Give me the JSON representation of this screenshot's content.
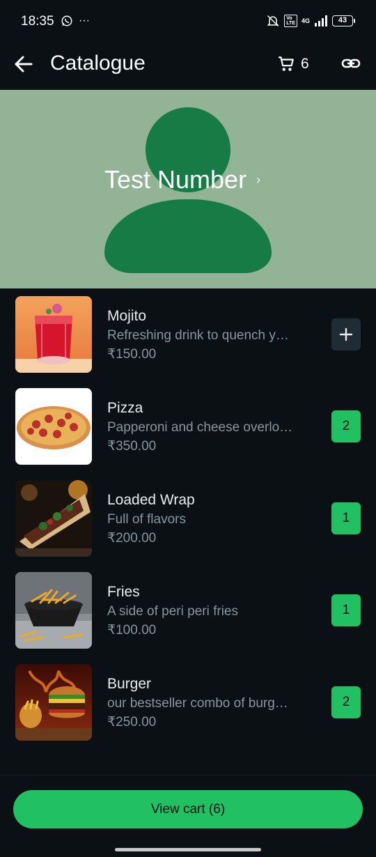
{
  "status_bar": {
    "time": "18:35",
    "more": "···",
    "network_label": "4G",
    "lte_label": "Vo\nLTE",
    "battery": "43"
  },
  "app_bar": {
    "title": "Catalogue",
    "cart_count": "6"
  },
  "banner": {
    "title": "Test Number",
    "chevron": "›",
    "background_color": "#93b397",
    "avatar_color": "#167b45"
  },
  "products": [
    {
      "name": "Mojito",
      "description": "Refreshing drink to quench y…",
      "price": "₹150.00",
      "quantity": null,
      "thumb": "mojito"
    },
    {
      "name": "Pizza",
      "description": "Papperoni and cheese overlo…",
      "price": "₹350.00",
      "quantity": "2",
      "thumb": "pizza"
    },
    {
      "name": "Loaded Wrap",
      "description": "Full of flavors",
      "price": "₹200.00",
      "quantity": "1",
      "thumb": "wrap"
    },
    {
      "name": "Fries",
      "description": "A side of peri peri fries",
      "price": "₹100.00",
      "quantity": "1",
      "thumb": "fries"
    },
    {
      "name": "Burger",
      "description": "our bestseller combo of burg…",
      "price": "₹250.00",
      "quantity": "2",
      "thumb": "burger"
    }
  ],
  "bottom": {
    "view_cart_label": "View cart (6)"
  },
  "colors": {
    "accent": "#21c063",
    "background": "#0b1014",
    "secondary_text": "#8696a0"
  }
}
